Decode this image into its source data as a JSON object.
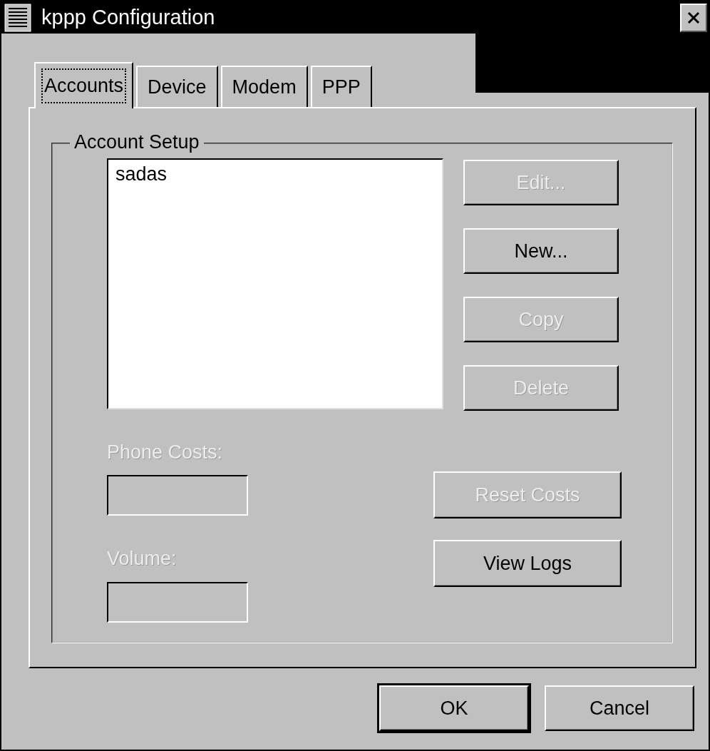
{
  "window": {
    "title": "kppp Configuration"
  },
  "tabs": [
    {
      "label": "Accounts",
      "selected": true,
      "focused": true
    },
    {
      "label": "Device",
      "selected": false,
      "focused": false
    },
    {
      "label": "Modem",
      "selected": false,
      "focused": false
    },
    {
      "label": "PPP",
      "selected": false,
      "focused": false
    }
  ],
  "account_setup": {
    "title": "Account Setup",
    "accounts": [
      {
        "name": "sadas",
        "selected": false
      }
    ],
    "buttons": [
      {
        "label": "Edit...",
        "disabled": true
      },
      {
        "label": "New...",
        "disabled": false
      },
      {
        "label": "Copy",
        "disabled": true
      },
      {
        "label": "Delete",
        "disabled": true
      }
    ],
    "phone_costs": {
      "label": "Phone Costs:",
      "disabled": true
    },
    "volume": {
      "label": "Volume:",
      "disabled": true
    },
    "reset_button": {
      "label": "Reset Costs",
      "disabled": true
    },
    "view_logs_button": {
      "label": "View Logs",
      "disabled": false
    }
  },
  "footer_buttons": [
    {
      "label": "OK",
      "default": true
    },
    {
      "label": "Cancel",
      "default": false
    }
  ]
}
